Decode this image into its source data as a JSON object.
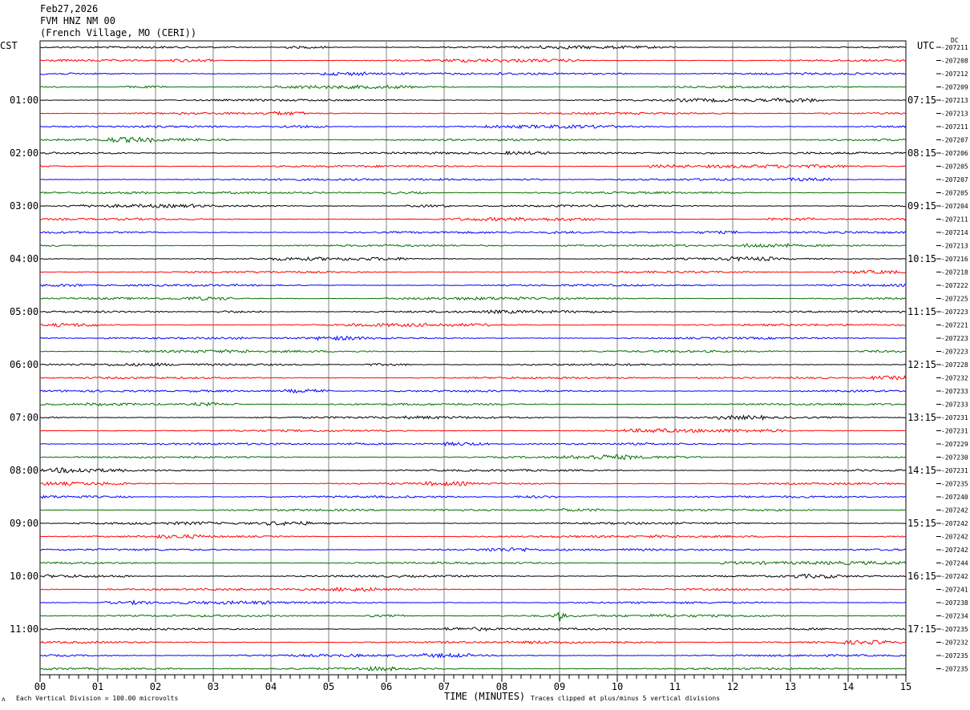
{
  "header": {
    "date": "Feb27,2026",
    "station": "FVM HNZ NM 00",
    "location": "(French Village, MO (CERI))"
  },
  "left_zone": "CST",
  "right_zone": "UTC",
  "right_corner_label": "DC",
  "footer": {
    "scale_note": "Each Vertical Division = 100.00 microvolts",
    "xlabel": "TIME (MINUTES)",
    "clip_note": "Traces clipped at plus/minus 5 vertical divisions",
    "corner_mark": "ᴧ"
  },
  "colors": {
    "line1": "#000000",
    "line2": "#ff0000",
    "line3": "#0000ff",
    "line4": "#007000",
    "grid": "#808080"
  },
  "chart_data": {
    "type": "line",
    "title": "FVM HNZ NM 00",
    "xlabel": "TIME (MINUTES)",
    "xlim": [
      0,
      15
    ],
    "x_ticks": [
      "00",
      "01",
      "02",
      "03",
      "04",
      "05",
      "06",
      "07",
      "08",
      "09",
      "10",
      "11",
      "12",
      "13",
      "14",
      "15"
    ],
    "lines_per_hour": 4,
    "line_minutes": 15,
    "left_time_labels": [
      "01:00",
      "02:00",
      "03:00",
      "04:00",
      "05:00",
      "06:00",
      "07:00",
      "08:00",
      "09:00",
      "10:00",
      "11:00"
    ],
    "right_time_labels": [
      "07:15",
      "08:15",
      "09:15",
      "10:15",
      "11:15",
      "12:15",
      "13:15",
      "14:15",
      "15:15",
      "16:15",
      "17:15"
    ],
    "dc_offsets": [
      "-207211",
      "-207208",
      "-207212",
      "-207209",
      "-207213",
      "-207213",
      "-207211",
      "-207207",
      "-207206",
      "-207205",
      "-207207",
      "-207205",
      "-207204",
      "-207211",
      "-207214",
      "-207213",
      "-207216",
      "-207218",
      "-207222",
      "-207225",
      "-207223",
      "-207221",
      "-207223",
      "-207223",
      "-207228",
      "-207232",
      "-207233",
      "-207233",
      "-207231",
      "-207231",
      "-207229",
      "-207230",
      "-207231",
      "-207235",
      "-207240",
      "-207242",
      "-207242",
      "-207242",
      "-207242",
      "-207244",
      "-207242",
      "-207241",
      "-207238",
      "-207234",
      "-207235",
      "-207232",
      "-207235",
      "-207235"
    ],
    "event": {
      "line": 43,
      "minute": 9.0,
      "label": ""
    }
  }
}
